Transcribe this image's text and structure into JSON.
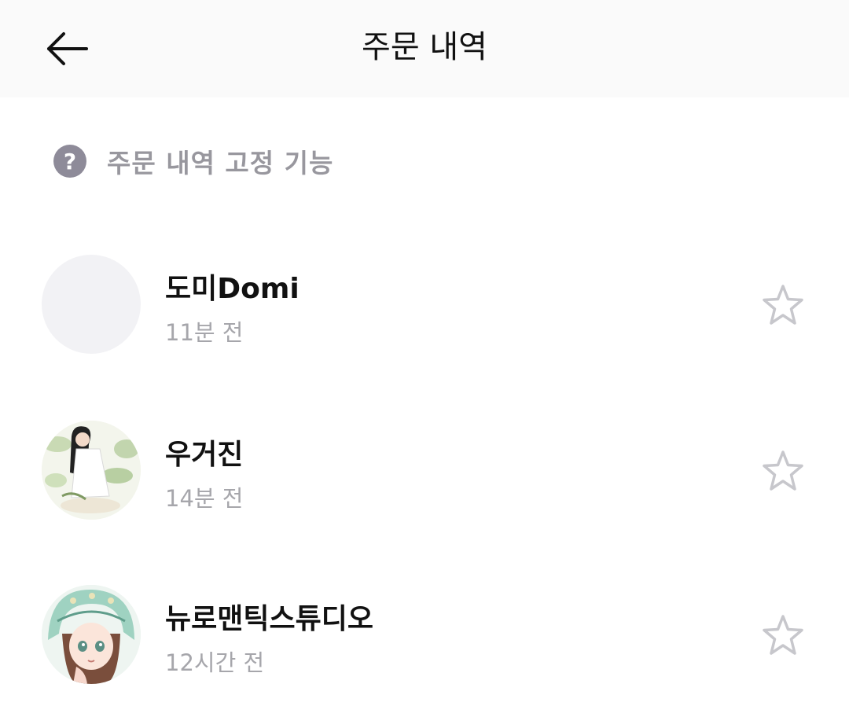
{
  "header": {
    "title": "주문 내역",
    "back_icon": "arrow-left-icon"
  },
  "help": {
    "icon": "question-circle-icon",
    "label": "주문 내역 고정 기능",
    "icon_color": "#8e8b99"
  },
  "orders": [
    {
      "name": "도미Domi",
      "time": "11분 전",
      "avatar": "blank",
      "favorite": false
    },
    {
      "name": "우거진",
      "time": "14분 전",
      "avatar": "illustration-girl-in-plants",
      "favorite": false
    },
    {
      "name": "뉴로맨틱스튜디오",
      "time": "12시간 전",
      "avatar": "illustration-girl-with-green-hood",
      "favorite": false
    }
  ],
  "icons": {
    "favorite": "star-outline-icon"
  },
  "colors": {
    "header_bg": "#fafafa",
    "secondary_text": "#a6a6ab",
    "star_outline": "#c7c7cc"
  }
}
